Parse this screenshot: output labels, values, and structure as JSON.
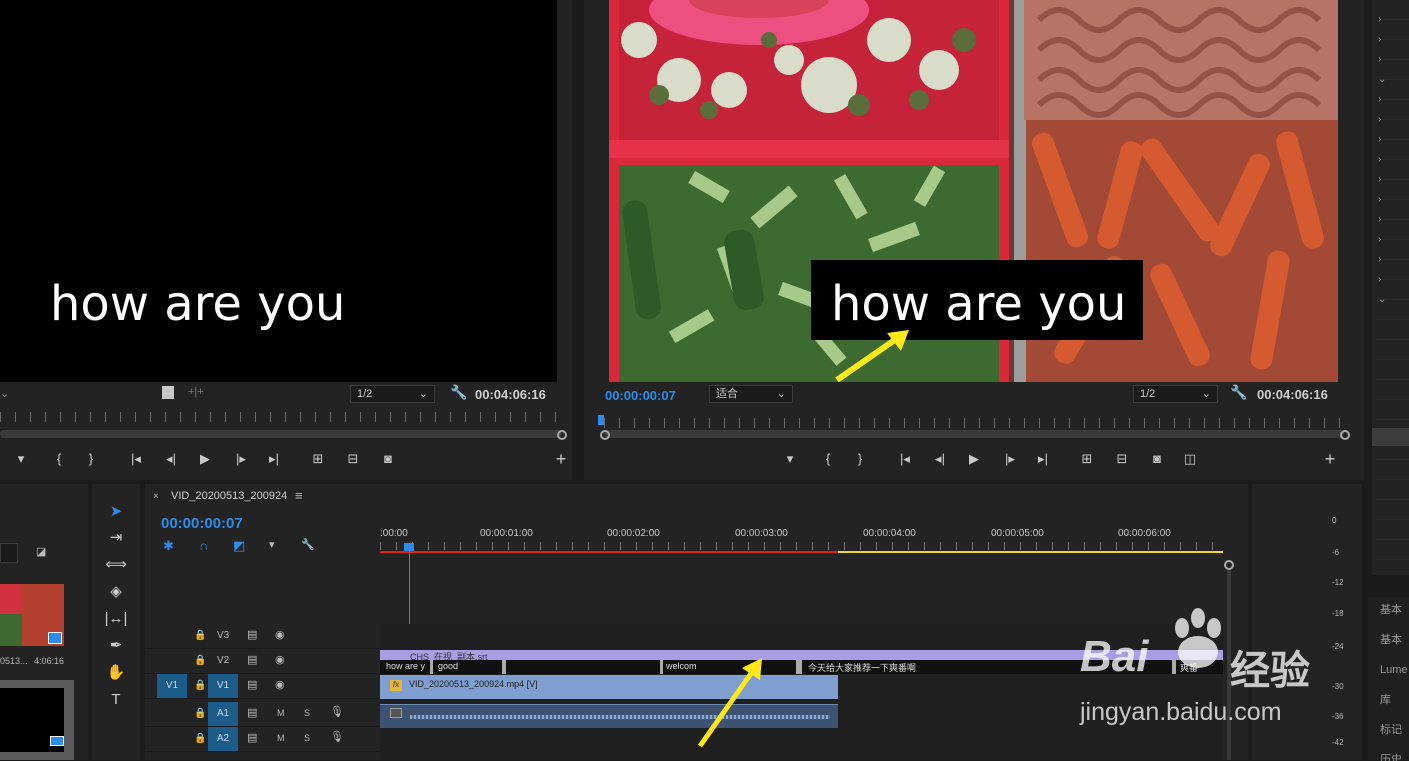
{
  "source_monitor": {
    "subtitle": "how are you",
    "scale": "1/2",
    "duration": "00:04:06:16"
  },
  "program_monitor": {
    "subtitle": "how are you",
    "timecode": "00:00:00:07",
    "fit": "适合",
    "scale": "1/2",
    "duration": "00:04:06:16"
  },
  "project_panel": {
    "clip_name": "0513...",
    "clip_duration": "4:06:16"
  },
  "timeline": {
    "tab_title": "VID_20200513_200924",
    "timecode": "00:00:00:07",
    "ruler_labels": [
      ":00:00",
      "00:00:01:00",
      "00:00:02:00",
      "00:00:03:00",
      "00:00:04:00",
      "00:00:05:00",
      "00:00:06:00"
    ],
    "tracks": [
      {
        "name": "V3",
        "label": "V3"
      },
      {
        "name": "V2",
        "label": "V2"
      },
      {
        "name": "V1",
        "label": "V1",
        "source": "V1"
      },
      {
        "name": "A1",
        "label": "A1",
        "m": "M",
        "s": "S"
      },
      {
        "name": "A2",
        "label": "A2",
        "m": "M",
        "s": "S"
      }
    ],
    "caption_track_title": "CHS_在视_副本.srt",
    "captions": [
      "how are y",
      "good",
      "welcom",
      "今天给大家推荐一下爽番啊",
      "爽番"
    ],
    "video_clip": "VID_20200513_200924.mp4 [V]",
    "fx": "fx"
  },
  "audio_meter": [
    "0",
    "-6",
    "-12",
    "-18",
    "-24",
    "-30",
    "-36",
    "-42"
  ],
  "right_panel": [
    "基本",
    "基本",
    "Lume",
    "库",
    "标记",
    "历史"
  ],
  "watermark": {
    "brand": "Bai",
    "brand2": "经验",
    "url": "jingyan.baidu.com"
  },
  "colors": {
    "accent": "#2d8ceb",
    "clip_video": "#7f9fd0",
    "clip_caption": "#a99de3",
    "annotation": "#ffe91a"
  }
}
